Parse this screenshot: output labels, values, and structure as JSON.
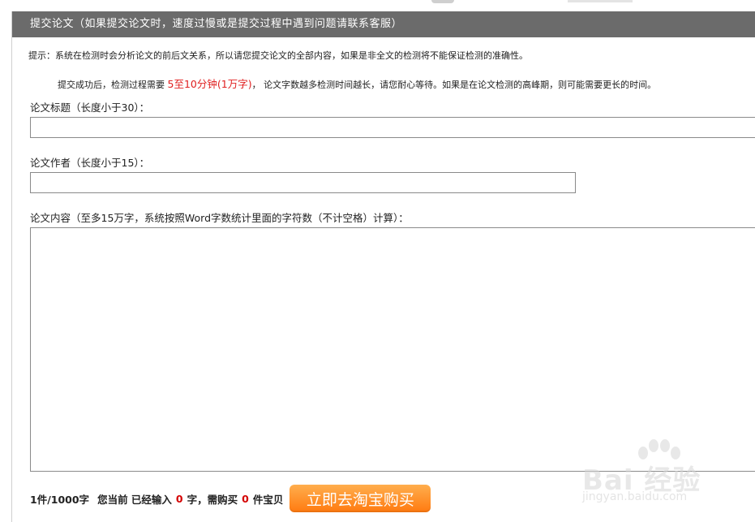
{
  "header": {
    "title": "提交论文（如果提交论文时，速度过慢或是提交过程中遇到问题请联系客服）"
  },
  "tips": {
    "line1": "提示：系统在检测时会分析论文的前后文关系，所以请您提交论文的全部内容，如果是非全文的检测将不能保证检测的准确性。",
    "line2_a": "提交成功后，检测过程需要 ",
    "line2_time": "5至10分钟(1万字)",
    "line2_b": "， 论文字数越多检测时间越长，请您耐心等待。如果是在论文检测的高峰期，则可能需要更长的时间。"
  },
  "form": {
    "title_label": "论文标题（长度小于30）：",
    "title_value": "",
    "author_label": "论文作者（长度小于15）：",
    "author_value": "",
    "content_label": "论文内容（至多15万字，系统按照Word字数统计里面的字符数（不计空格）计算）：",
    "content_value": ""
  },
  "footer": {
    "rate": "1件/1000字",
    "current_prefix": "您当前 已经输入",
    "chars_count": "0",
    "chars_suffix": "字，需购买",
    "items_count": "0",
    "items_suffix": "件宝贝",
    "buy_label": "立即去淘宝购买"
  },
  "watermark": {
    "brand": "Bai 经验",
    "site": "jingyan.baidu.com"
  },
  "colors": {
    "header_bg": "#6b6b6b",
    "accent_red": "#e02020",
    "button_orange": "#ff8a1f"
  }
}
